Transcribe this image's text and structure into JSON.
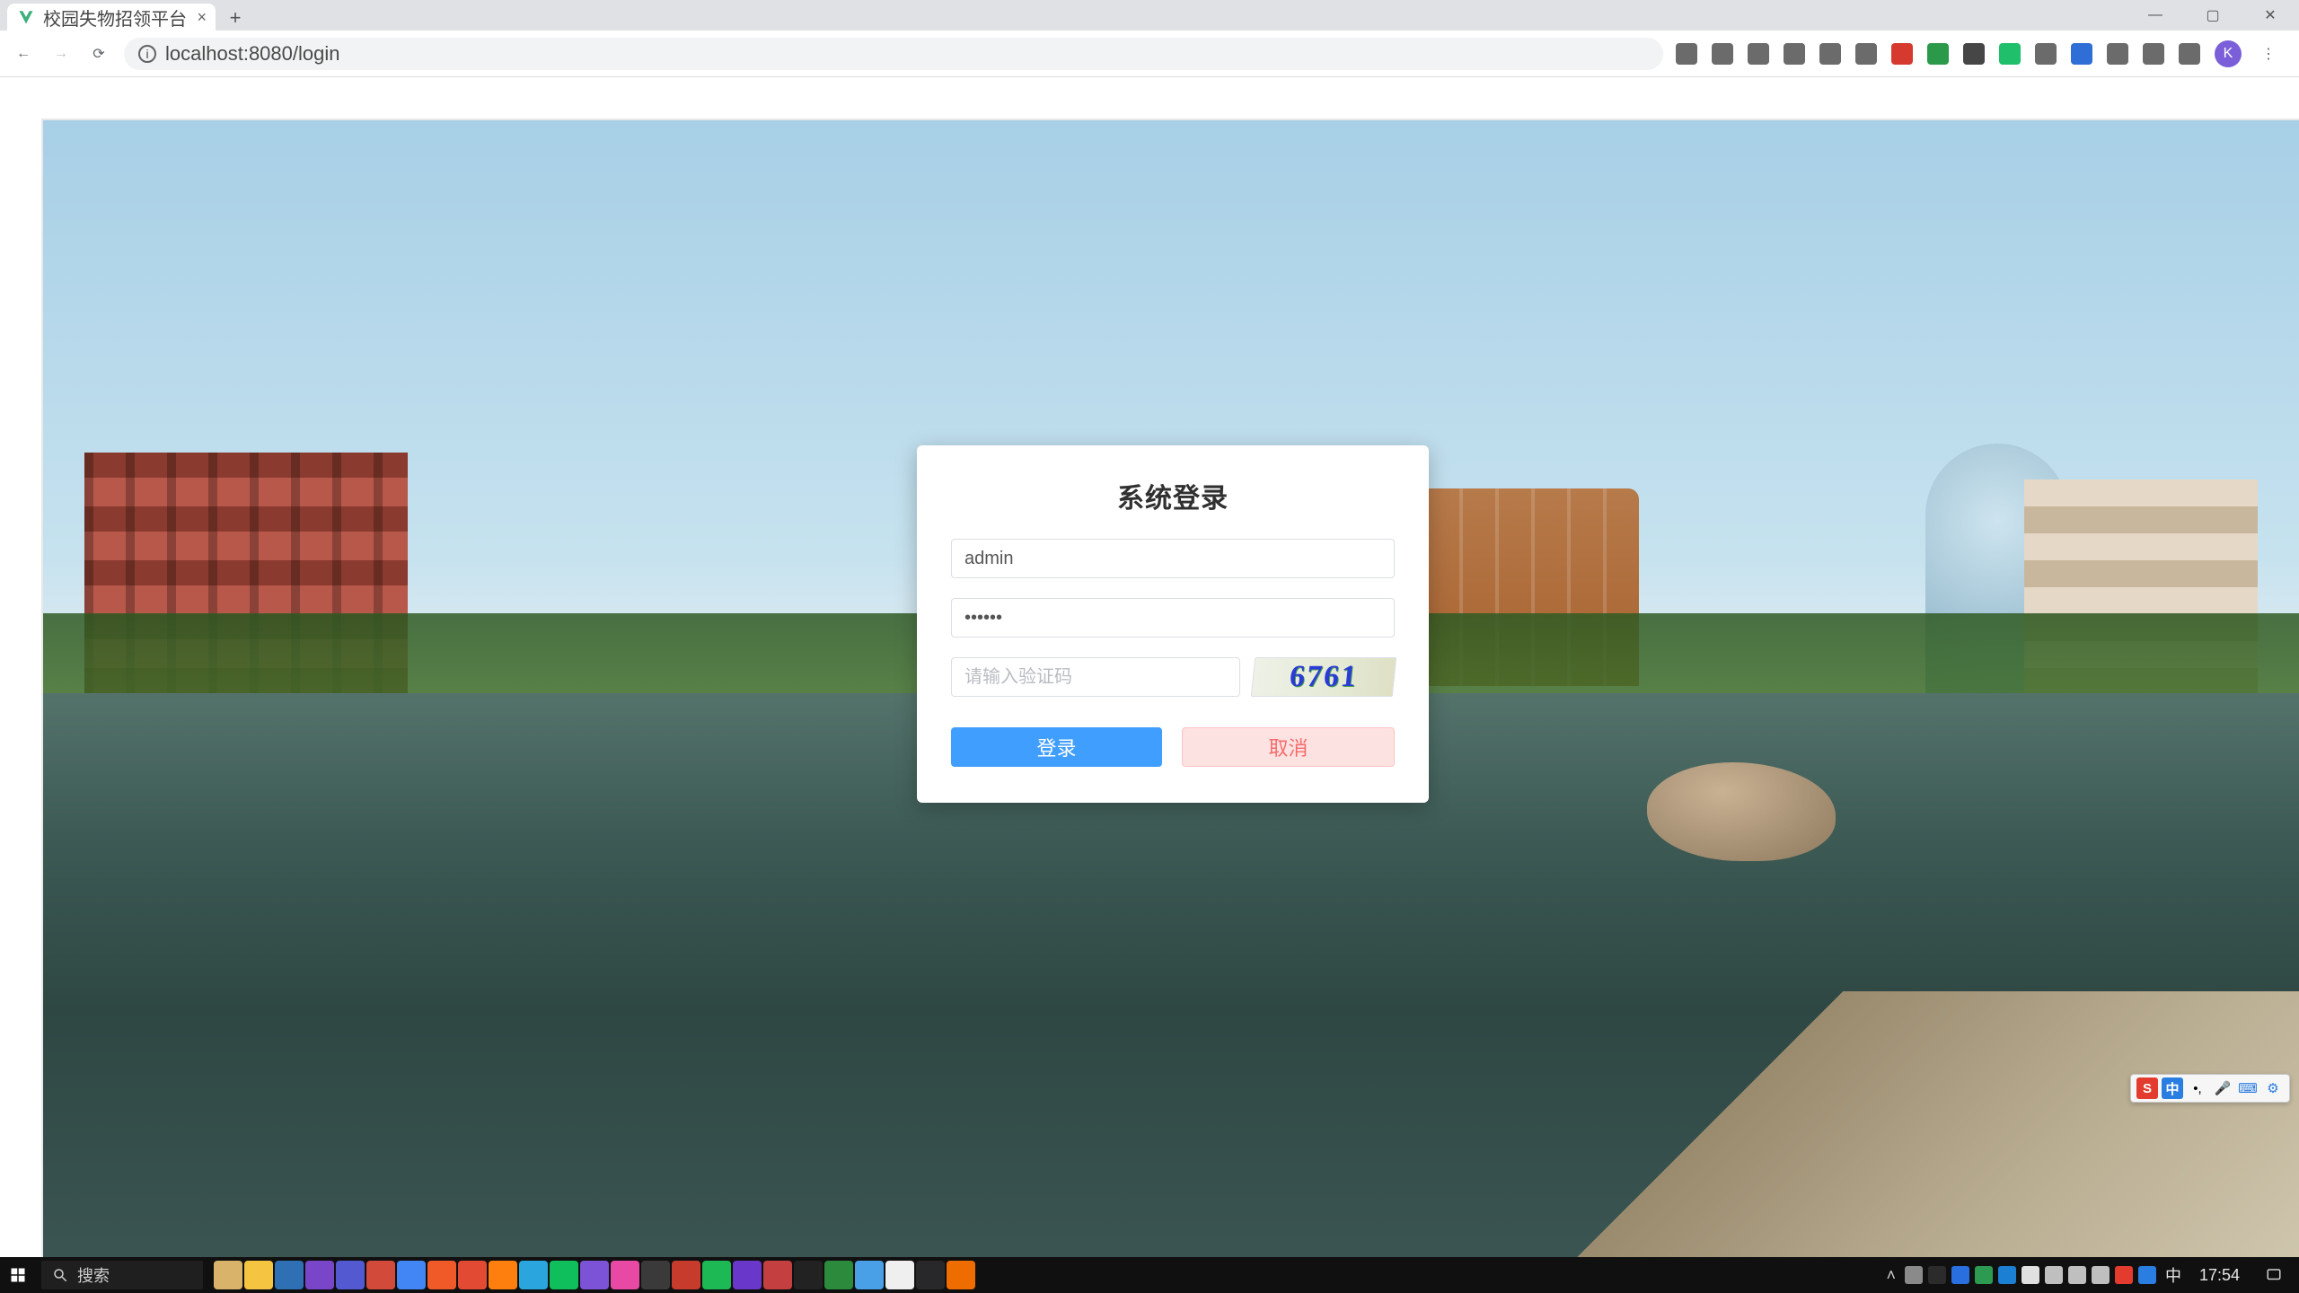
{
  "browser": {
    "tab_title": "校园失物招领平台",
    "window_controls": {
      "min": "—",
      "max": "▢",
      "close": "✕"
    },
    "nav": {
      "back": "←",
      "forward": "→",
      "reload": "⟳"
    },
    "address": "localhost:8080/login"
  },
  "login": {
    "title": "系统登录",
    "username_value": "admin",
    "password_value": "••••••",
    "captcha_placeholder": "请输入验证码",
    "captcha_code": "6761",
    "submit_label": "登录",
    "cancel_label": "取消"
  },
  "ime": {
    "logo": "S",
    "lang": "中"
  },
  "taskbar": {
    "search_placeholder": "搜索",
    "ime_tray": "中",
    "clock": "17:54",
    "app_colors": [
      "#d9b36a",
      "#f5c542",
      "#2f6fb3",
      "#7a46c9",
      "#535ad1",
      "#d14a3a",
      "#4285f4",
      "#ef5a28",
      "#e24a33",
      "#ff7f0e",
      "#2aa5de",
      "#0fbf5c",
      "#7c53d6",
      "#e749a4",
      "#3a3a3a",
      "#c73b2c",
      "#1db954",
      "#6937c9",
      "#c44040",
      "#222222",
      "#2c8a3d",
      "#4aa0e6",
      "#efefef",
      "#28282a",
      "#ef6c00"
    ],
    "tray_colors": [
      "#8a8a8a",
      "#2b2b2b",
      "#2a6fe0",
      "#2d9a52",
      "#1b7fd4",
      "#e0e0e0",
      "#bfbfbf",
      "#bfbfbf",
      "#bfbfbf",
      "#e33b2e",
      "#2a7de1"
    ]
  }
}
